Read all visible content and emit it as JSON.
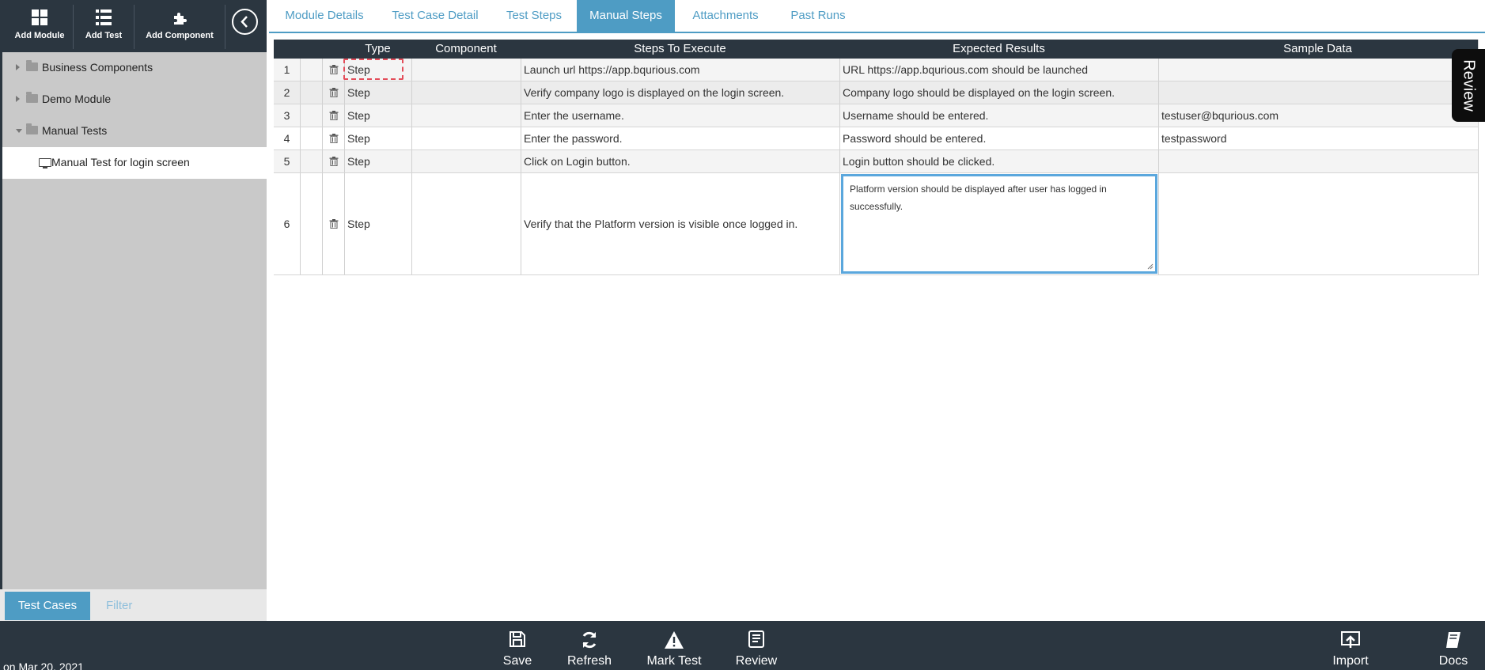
{
  "toolbar": {
    "add_module": "Add Module",
    "add_test": "Add Test",
    "add_component": "Add Component"
  },
  "tree": {
    "items": [
      {
        "label": "Business Components"
      },
      {
        "label": "Demo Module"
      },
      {
        "label": "Manual Tests"
      },
      {
        "label": "Manual Test for login screen"
      }
    ]
  },
  "sidebar_tabs": {
    "test_cases": "Test Cases",
    "filter": "Filter"
  },
  "tabs": [
    {
      "label": "Module Details"
    },
    {
      "label": "Test Case Detail"
    },
    {
      "label": "Test Steps"
    },
    {
      "label": "Manual Steps",
      "active": true
    },
    {
      "label": "Attachments"
    },
    {
      "label": "Past Runs"
    }
  ],
  "grid": {
    "headers": {
      "type": "Type",
      "component": "Component",
      "steps": "Steps To Execute",
      "expected": "Expected Results",
      "sample": "Sample Data"
    },
    "rows": [
      {
        "num": "1",
        "type": "Step",
        "component": "",
        "steps": "Launch url https://app.bqurious.com",
        "expected": "URL https://app.bqurious.com should be launched",
        "sample": ""
      },
      {
        "num": "2",
        "type": "Step",
        "component": "",
        "steps": "Verify company logo is displayed on the login screen.",
        "expected": "Company logo should be displayed on the login screen.",
        "sample": ""
      },
      {
        "num": "3",
        "type": "Step",
        "component": "",
        "steps": "Enter the username.",
        "expected": "Username should be entered.",
        "sample": "testuser@bqurious.com"
      },
      {
        "num": "4",
        "type": "Step",
        "component": "",
        "steps": "Enter the password.",
        "expected": "Password should be entered.",
        "sample": "testpassword"
      },
      {
        "num": "5",
        "type": "Step",
        "component": "",
        "steps": "Click on Login button.",
        "expected": "Login button should be clicked.",
        "sample": ""
      },
      {
        "num": "6",
        "type": "Step",
        "component": "",
        "steps": "Verify that the Platform version is visible once logged in.",
        "expected": "Platform version should be displayed after user has logged in successfully.",
        "sample": ""
      }
    ]
  },
  "review_tab": "Review",
  "bottom_bar": {
    "save": "Save",
    "refresh": "Refresh",
    "mark_test": "Mark Test",
    "review": "Review",
    "import": "Import",
    "docs": "Docs"
  },
  "footer_date": "on Mar 20, 2021",
  "colors": {
    "dark": "#2b3640",
    "accent": "#4e9cc4",
    "sidebar_bg": "#c9c9c9",
    "editor_border": "#5aa7dd",
    "type_outline": "#e34d5a"
  }
}
